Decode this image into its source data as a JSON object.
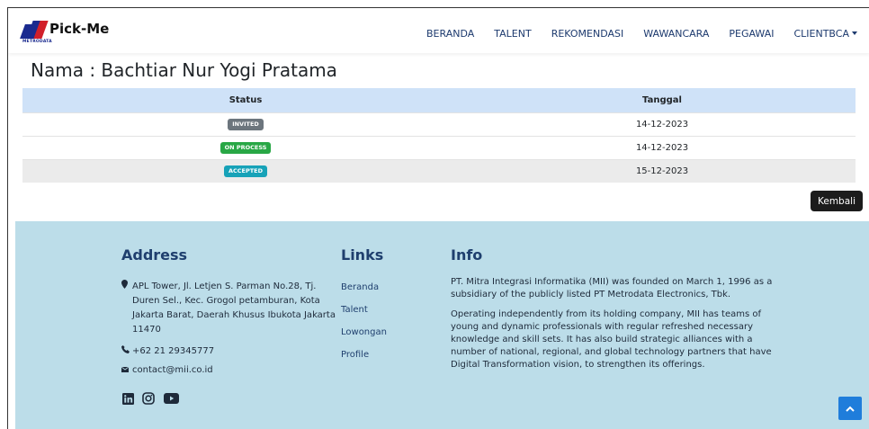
{
  "brand": {
    "name": "Pick-Me",
    "sub": "METRODATA"
  },
  "nav": {
    "items": [
      "BERANDA",
      "TALENT",
      "REKOMENDASI",
      "WAWANCARA",
      "PEGAWAI",
      "CLIENTBCA"
    ]
  },
  "page": {
    "title": "Nama : Bachtiar Nur Yogi Pratama"
  },
  "table": {
    "headers": [
      "Status",
      "Tanggal"
    ],
    "rows": [
      {
        "status": "INVITED",
        "badge_color": "#6c757d",
        "date": "14-12-2023"
      },
      {
        "status": "ON PROCESS",
        "badge_color": "#28a745",
        "date": "14-12-2023"
      },
      {
        "status": "ACCEPTED",
        "badge_color": "#17a2b8",
        "date": "15-12-2023"
      }
    ]
  },
  "actions": {
    "back_label": "Kembali"
  },
  "footer": {
    "address_title": "Address",
    "address": "APL Tower, Jl. Letjen S. Parman No.28, Tj. Duren Sel., Kec. Grogol petamburan, Kota Jakarta Barat, Daerah Khusus Ibukota Jakarta 11470",
    "phone": "+62 21 29345777",
    "email": "contact@mii.co.id",
    "links_title": "Links",
    "links": [
      "Beranda",
      "Talent",
      "Lowongan",
      "Profile"
    ],
    "info_title": "Info",
    "info_p1": "PT. Mitra Integrasi Informatika (MII) was founded on March 1, 1996 as a subsidiary of the publicly listed PT Metrodata Electronics, Tbk.",
    "info_p2": "Operating independently from its holding company, MII has teams of young and dynamic professionals with regular refreshed necessary knowledge and skill sets. It has also build strategic alliances with a number of national, regional, and global technology partners that have Digital Transformation vision, to strengthen its offerings.",
    "social_icons": [
      "linkedin-icon",
      "instagram-icon",
      "youtube-icon"
    ]
  },
  "colors": {
    "navy": "#1f3f6e",
    "footer_bg": "#bcdde9",
    "header_bg": "#cfe2f8",
    "scroll_btn": "#1f7ddb"
  }
}
